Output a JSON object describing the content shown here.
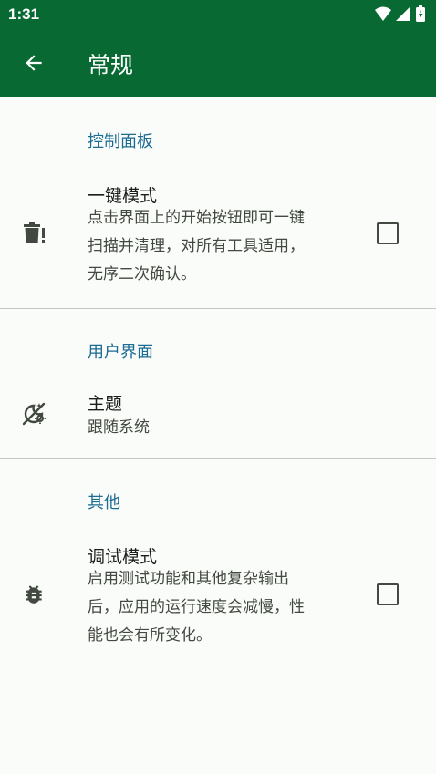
{
  "status_bar": {
    "time": "1:31",
    "icons": [
      "wifi-icon",
      "signal-icon",
      "battery-charging-icon"
    ]
  },
  "app_bar": {
    "title": "常规",
    "back_icon": "arrow-back-icon"
  },
  "sections": [
    {
      "header": "控制面板",
      "items": [
        {
          "icon": "trash-alert-icon",
          "title": "一键模式",
          "summary_lines": [
            "点击界面上的开始按钮即可一键",
            "扫描并清理，对所有工具适用，",
            "无序二次确认。"
          ],
          "checkbox": false
        }
      ]
    },
    {
      "header": "用户界面",
      "items": [
        {
          "icon": "theme-auto-icon",
          "title": "主题",
          "summary": "跟随系统"
        }
      ]
    },
    {
      "header": "其他",
      "items": [
        {
          "icon": "bug-icon",
          "title": "调试模式",
          "summary_lines": [
            "启用测试功能和其他复杂输出",
            "后，应用的运行速度会减慢，性",
            "能也会有所变化。"
          ],
          "checkbox": false
        }
      ]
    }
  ],
  "colors": {
    "primary": "#086a32",
    "background": "#fafcf9",
    "section_header": "#1b6b93",
    "divider": "#c4c8c0"
  }
}
